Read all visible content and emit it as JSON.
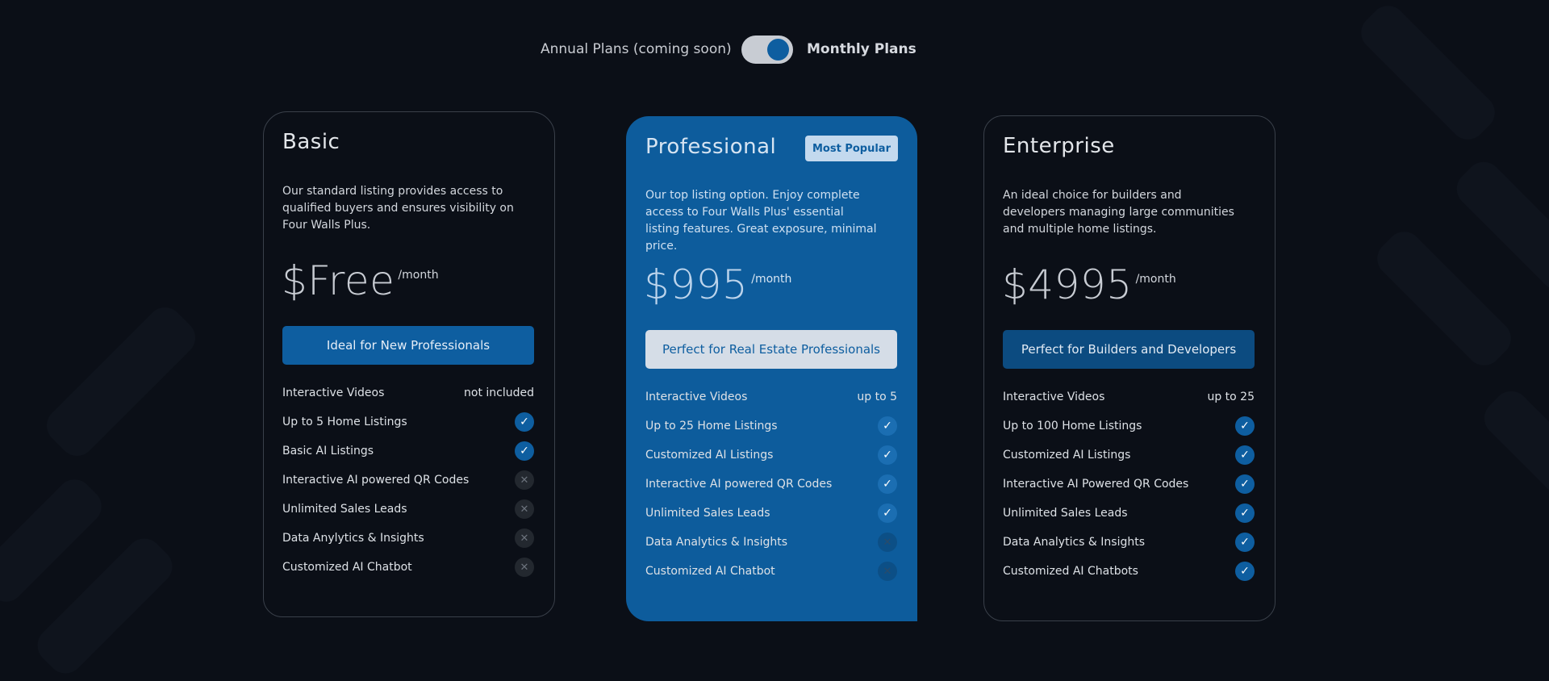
{
  "billing_toggle": {
    "annual_label": "Annual Plans (coming soon)",
    "monthly_label": "Monthly Plans",
    "selected": "monthly"
  },
  "plans": [
    {
      "name": "Basic",
      "description": "Our standard listing provides access to qualified buyers and ensures visibility on Four Walls Plus.",
      "price": "$Free",
      "period": "/month",
      "cta": "Ideal for New Professionals",
      "features": [
        {
          "label": "Interactive Videos",
          "value": "not included"
        },
        {
          "label": "Up to 5 Home Listings",
          "status": "check"
        },
        {
          "label": "Basic AI Listings",
          "status": "check"
        },
        {
          "label": "Interactive AI powered QR Codes",
          "status": "cross"
        },
        {
          "label": "Unlimited Sales Leads",
          "status": "cross"
        },
        {
          "label": "Data Anylytics & Insights",
          "status": "cross"
        },
        {
          "label": "Customized AI Chatbot",
          "status": "cross"
        }
      ]
    },
    {
      "name": "Professional",
      "badge": "Most Popular",
      "description": "Our top listing option. Enjoy complete access to Four Walls Plus' essential listing features. Great exposure, minimal price.",
      "price": "$995",
      "period": "/month",
      "cta": "Perfect for Real Estate Professionals",
      "features": [
        {
          "label": "Interactive Videos",
          "value": "up to 5"
        },
        {
          "label": "Up to 25 Home Listings",
          "status": "check"
        },
        {
          "label": "Customized AI Listings",
          "status": "check"
        },
        {
          "label": "Interactive AI powered QR Codes",
          "status": "check"
        },
        {
          "label": "Unlimited Sales Leads",
          "status": "check"
        },
        {
          "label": "Data Analytics & Insights",
          "status": "cross"
        },
        {
          "label": "Customized AI Chatbot",
          "status": "cross"
        }
      ]
    },
    {
      "name": "Enterprise",
      "description": "An ideal choice for builders and developers managing large communities and multiple home listings.",
      "price": "$4995",
      "period": "/month",
      "cta": "Perfect for Builders and Developers",
      "features": [
        {
          "label": "Interactive Videos",
          "value": "up to 25"
        },
        {
          "label": "Up to 100 Home Listings",
          "status": "check"
        },
        {
          "label": "Customized AI Listings",
          "status": "check"
        },
        {
          "label": "Interactive AI Powered QR Codes",
          "status": "check"
        },
        {
          "label": "Unlimited Sales Leads",
          "status": "check"
        },
        {
          "label": "Data Analytics & Insights",
          "status": "check"
        },
        {
          "label": "Customized AI Chatbots",
          "status": "check"
        }
      ]
    }
  ],
  "icons": {
    "check": "check-icon",
    "cross": "close-icon"
  },
  "colors": {
    "accent": "#0e5ea0",
    "background": "#0b0f17",
    "featured_card": "#0d5c9c"
  }
}
